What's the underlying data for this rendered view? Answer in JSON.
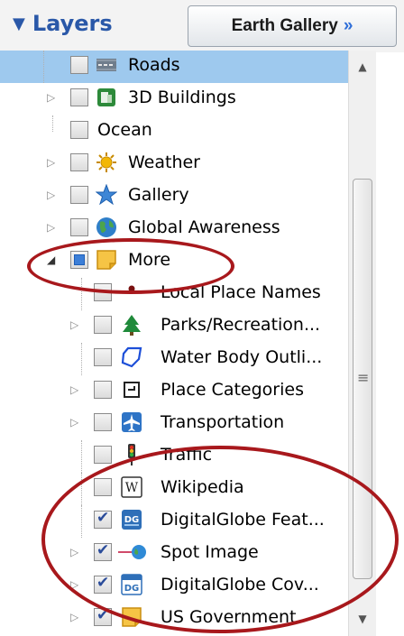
{
  "header": {
    "layers_label": "Layers",
    "gallery_button": "Earth Gallery",
    "gallery_chevron": "»"
  },
  "colors": {
    "accent": "#2a58a8",
    "selection": "#9ec9ee",
    "annotation": "#a8181c"
  },
  "layers": [
    {
      "label": "Roads",
      "icon": "road-icon",
      "checked": false,
      "expandable": false,
      "selected": true
    },
    {
      "label": "3D Buildings",
      "icon": "building-icon",
      "checked": false,
      "expandable": true
    },
    {
      "label": "Ocean",
      "icon": "",
      "checked": false,
      "expandable": false
    },
    {
      "label": "Weather",
      "icon": "sun-icon",
      "checked": false,
      "expandable": true
    },
    {
      "label": "Gallery",
      "icon": "star-icon",
      "checked": false,
      "expandable": true
    },
    {
      "label": "Global Awareness",
      "icon": "globe-icon",
      "checked": false,
      "expandable": true
    },
    {
      "label": "More",
      "icon": "folder-icon",
      "checked": "partial",
      "expandable": true,
      "expanded": true
    },
    {
      "label": "Local Place Names",
      "icon": "dot-icon",
      "checked": false,
      "expandable": false,
      "child": true
    },
    {
      "label": "Parks/Recreation...",
      "icon": "tree-icon",
      "checked": false,
      "expandable": true,
      "child": true
    },
    {
      "label": "Water Body Outli...",
      "icon": "outline-shape-icon",
      "checked": false,
      "expandable": false,
      "child": true
    },
    {
      "label": "Place Categories",
      "icon": "category-icon",
      "checked": false,
      "expandable": true,
      "child": true
    },
    {
      "label": "Transportation",
      "icon": "airplane-icon",
      "checked": false,
      "expandable": true,
      "child": true
    },
    {
      "label": "Traffic",
      "icon": "traffic-light-icon",
      "checked": false,
      "expandable": false,
      "child": true
    },
    {
      "label": "Wikipedia",
      "icon": "wikipedia-icon",
      "checked": false,
      "expandable": false,
      "child": true
    },
    {
      "label": "DigitalGlobe Feat...",
      "icon": "dg-icon",
      "checked": true,
      "expandable": false,
      "child": true
    },
    {
      "label": "Spot Image",
      "icon": "spot-image-icon",
      "checked": true,
      "expandable": true,
      "child": true
    },
    {
      "label": "DigitalGlobe Cov...",
      "icon": "dg-coverage-icon",
      "checked": true,
      "expandable": true,
      "child": true
    },
    {
      "label": "US Government",
      "icon": "folder-icon",
      "checked": true,
      "expandable": true,
      "child": true
    }
  ]
}
